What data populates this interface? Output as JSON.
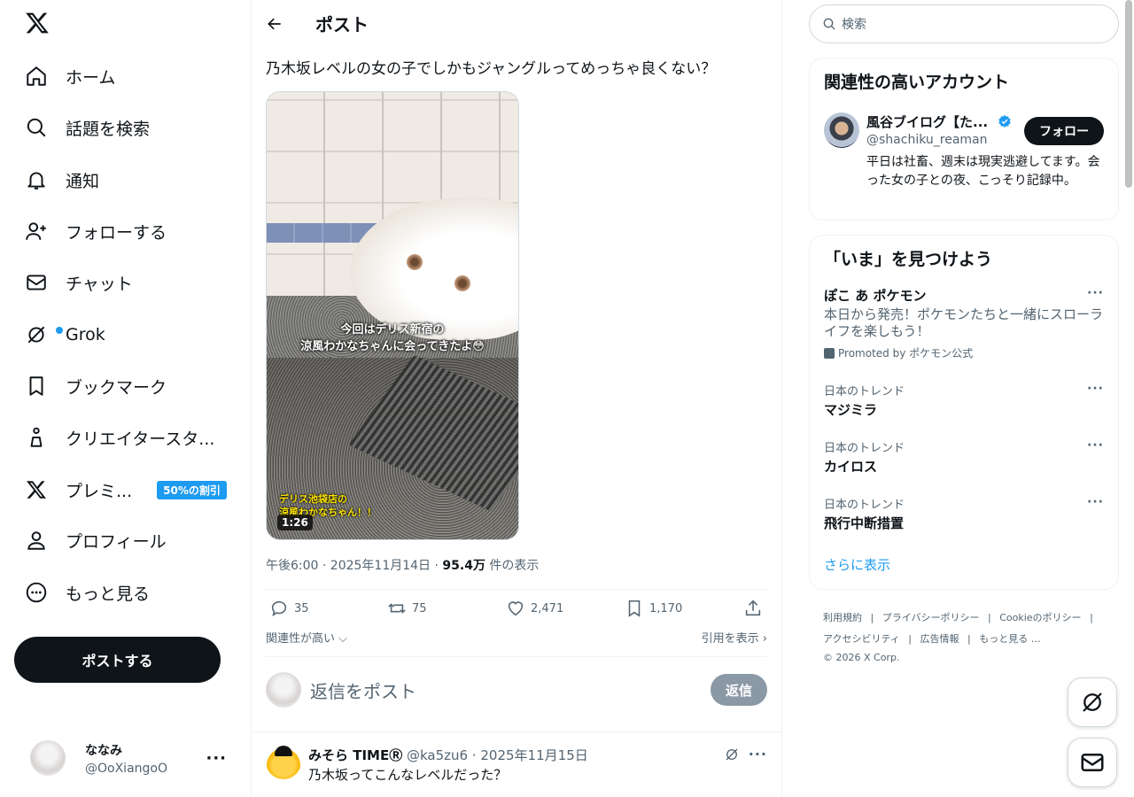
{
  "nav": {
    "items": [
      {
        "label": "ホーム",
        "icon": "home-icon"
      },
      {
        "label": "話題を検索",
        "icon": "search-icon"
      },
      {
        "label": "通知",
        "icon": "bell-icon"
      },
      {
        "label": "フォローする",
        "icon": "person-add-icon"
      },
      {
        "label": "チャット",
        "icon": "mail-icon"
      },
      {
        "label": "Grok",
        "icon": "grok-icon"
      },
      {
        "label": "ブックマーク",
        "icon": "bookmark-icon"
      },
      {
        "label": "クリエイタースタ...",
        "icon": "creator-icon"
      },
      {
        "label": "プレミ...",
        "icon": "x-premium-icon",
        "badge": "50%の割引"
      },
      {
        "label": "プロフィール",
        "icon": "person-icon"
      },
      {
        "label": "もっと見る",
        "icon": "more-circle-icon"
      }
    ],
    "post_button": "ポストする",
    "me": {
      "name": "ななみ",
      "handle": "@OoXiangoO"
    }
  },
  "main": {
    "header_title": "ポスト",
    "post_text": "乃木坂レベルの女の子でしかもジャングルってめっちゃ良くない？",
    "media": {
      "caption_line1": "今回はデリス新宿の",
      "caption_line2": "涼風わかなちゃんに会ってきたよ😳",
      "sub_caption_line1": "デリス池袋店の",
      "sub_caption_line2": "涼風わかなちゃん！！",
      "duration": "1:26"
    },
    "meta": {
      "time": "午後6:00 · 2025年11月14日 · ",
      "views": "95.4万",
      "views_label": " 件の表示"
    },
    "actions": {
      "replies": "35",
      "reposts": "75",
      "likes": "2,471",
      "bookmarks": "1,170"
    },
    "sort_label": "関連性が高い",
    "quotes_label": "引用を表示",
    "reply_placeholder": "返信をポスト",
    "reply_button": "返信",
    "reply1": {
      "name": "みそら TIMEⓇ",
      "handle_date": "@ka5zu6 · 2025年11月15日",
      "text": "乃木坂ってこんなレベルだった？"
    }
  },
  "right": {
    "search_placeholder": "検索",
    "related_title": "関連性の高いアカウント",
    "account": {
      "name": "風谷ブイログ【た...",
      "handle": "@shachiku_reaman",
      "bio": "平日は社畜、週末は現実逃避してます。会った女の子との夜、こっそり記録中。",
      "follow": "フォロー"
    },
    "explore_title": "「いま」を見つけよう",
    "promoted": {
      "title": "ぽこ あ ポケモン",
      "desc": "本日から発売！ポケモンたちと一緒にスローライフを楽しもう！",
      "promo": "Promoted by ポケモン公式"
    },
    "trends": [
      {
        "context": "日本のトレンド",
        "title": "マジミラ"
      },
      {
        "context": "日本のトレンド",
        "title": "カイロス"
      },
      {
        "context": "日本のトレンド",
        "title": "飛行中断措置"
      }
    ],
    "show_more": "さらに表示",
    "footer": {
      "line1": [
        "利用規約",
        "|",
        "プライバシーポリシー",
        "|",
        "Cookieのポリシー",
        "|"
      ],
      "line2": [
        "アクセシビリティ",
        "|",
        "広告情報",
        "|",
        "もっと見る …"
      ],
      "copyright": "© 2026 X Corp."
    }
  },
  "colors": {
    "accent": "#1d9bf0",
    "text": "#0f1419",
    "muted": "#536471"
  }
}
